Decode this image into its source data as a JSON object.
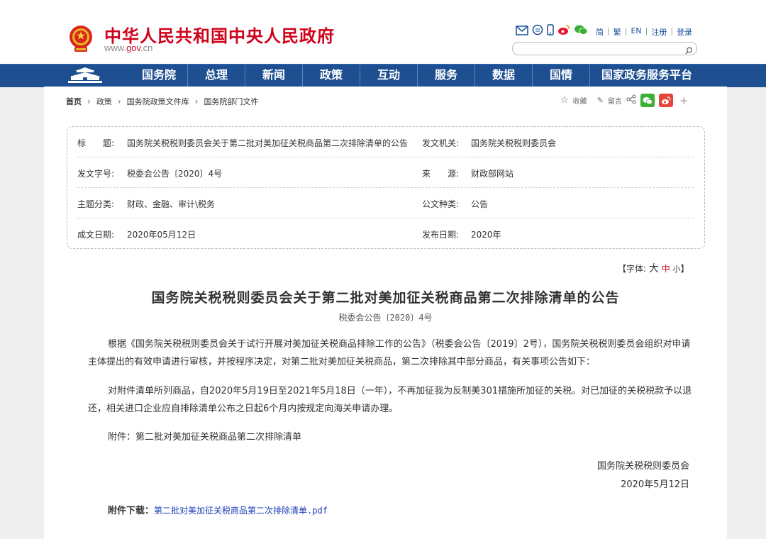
{
  "header": {
    "site_name": "中华人民共和国中央人民政府",
    "site_url_prefix": "www.",
    "site_url_gov": "gov",
    "site_url_suffix": ".cn",
    "lang_links": [
      "简",
      "繁",
      "EN",
      "注册",
      "登录"
    ],
    "search_placeholder": ""
  },
  "nav": {
    "items": [
      "国务院",
      "总理",
      "新闻",
      "政策",
      "互动",
      "服务",
      "数据",
      "国情",
      "国家政务服务平台"
    ]
  },
  "breadcrumb": [
    "首页",
    "政策",
    "国务院政策文件库",
    "国务院部门文件"
  ],
  "tools": {
    "collect": "收藏",
    "comment": "留言"
  },
  "meta": {
    "title_label": "标　　题:",
    "title_value": "国务院关税税则委员会关于第二批对美加征关税商品第二次排除清单的公告",
    "issuer_label": "发文机关:",
    "issuer_value": "国务院关税税则委员会",
    "docno_label": "发文字号:",
    "docno_value": "税委会公告〔2020〕4号",
    "source_label": "来　　源:",
    "source_value": "财政部网站",
    "topic_label": "主题分类:",
    "topic_value": "财政、金融、审计\\税务",
    "type_label": "公文种类:",
    "type_value": "公告",
    "created_label": "成文日期:",
    "created_value": "2020年05月12日",
    "published_label": "发布日期:",
    "published_value": "2020年"
  },
  "font_size": {
    "prefix": "【字体:",
    "large": "大",
    "medium": "中",
    "small": "小",
    "suffix": "】"
  },
  "document": {
    "title": "国务院关税税则委员会关于第二批对美加征关税商品第二次排除清单的公告",
    "number": "税委会公告〔2020〕4号",
    "para1": "根据《国务院关税税则委员会关于试行开展对美加征关税商品排除工作的公告》（税委会公告〔2019〕2号），国务院关税税则委员会组织对申请主体提出的有效申请进行审核，并按程序决定，对第二批对美加征关税商品，第二次排除其中部分商品，有关事项公告如下：",
    "para2": "对附件清单所列商品，自2020年5月19日至2021年5月18日（一年），不再加征我为反制美301措施所加征的关税。对已加征的关税税款予以退还，相关进口企业应自排除清单公布之日起6个月内按规定向海关申请办理。",
    "para3": "附件：第二批对美加征关税商品第二次排除清单",
    "signer": "国务院关税税则委员会",
    "sign_date": "2020年5月12日",
    "attach_label": "附件下载：",
    "attach_link": "第二批对美加征关税商品第二次排除清单.pdf"
  }
}
